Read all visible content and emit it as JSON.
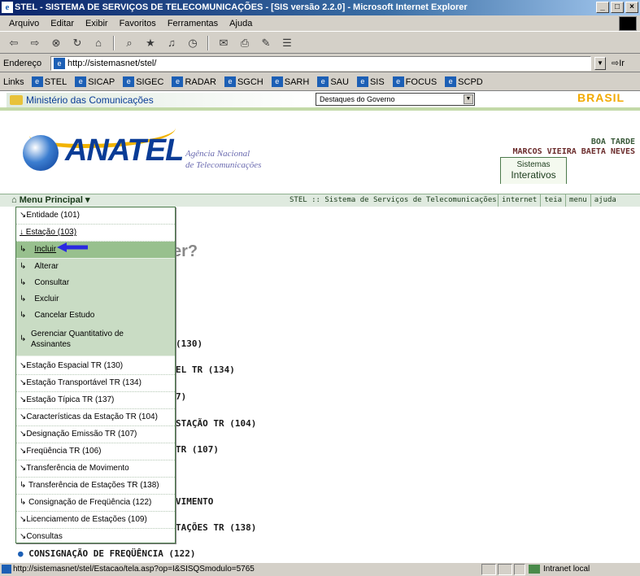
{
  "window": {
    "title": "STEL - SISTEMA DE SERVIÇOS DE TELECOMUNICAÇÕES - [SIS versão 2.2.0] - Microsoft Internet Explorer",
    "minimize": "_",
    "maximize": "□",
    "close": "×"
  },
  "menu": [
    "Arquivo",
    "Editar",
    "Exibir",
    "Favoritos",
    "Ferramentas",
    "Ajuda"
  ],
  "address": {
    "label": "Endereço",
    "url": "http://sistemasnet/stel/",
    "go": "Ir"
  },
  "links": {
    "label": "Links",
    "items": [
      "STEL",
      "SICAP",
      "SIGEC",
      "RADAR",
      "SGCH",
      "SARH",
      "SAU",
      "SIS",
      "FOCUS",
      "SCPD"
    ]
  },
  "gov": {
    "ministerio": "Ministério das Comunicações",
    "destaques": "Destaques do Governo",
    "brasil": "BRASIL"
  },
  "header": {
    "logo": "ANATEL",
    "agencia_l1": "Agência Nacional",
    "agencia_l2": "de Telecomunicações",
    "greeting": "BOA TARDE",
    "user": "MARCOS VIEIRA BAETA NEVES",
    "sistemas_l1": "Sistemas",
    "sistemas_l2": "Interativos"
  },
  "navbar": {
    "menu_principal": "Menu Principal ▾",
    "system": "STEL :: Sistema de Serviços de Telecomunicações",
    "links": [
      "internet",
      "teia",
      "menu",
      "ajuda"
    ]
  },
  "dropdown": {
    "items": [
      {
        "label": "↘Entidade (101)"
      },
      {
        "label": "↓ Estação (103)"
      },
      {
        "label": "Incluir"
      },
      {
        "label": "Alterar"
      },
      {
        "label": "Consultar"
      },
      {
        "label": "Excluir"
      },
      {
        "label": "Cancelar Estudo"
      },
      {
        "label": "Gerenciar Quantitativo de"
      },
      {
        "label": "Assinantes"
      },
      {
        "label": "↘Estação Espacial TR (130)"
      },
      {
        "label": "↘Estação Transportável TR (134)"
      },
      {
        "label": "↘Estação Típica TR (137)"
      },
      {
        "label": "↘Características da Estação TR (104)"
      },
      {
        "label": "↘Designação Emissão TR (107)"
      },
      {
        "label": "↘Freqüência TR (106)"
      },
      {
        "label": "↘Transferência de Movimento"
      },
      {
        "label": "↳ Transferência de Estações TR (138)"
      },
      {
        "label": "↳ Consignação de Freqüência (122)"
      },
      {
        "label": "↘Licenciamento de Estações (109)"
      },
      {
        "label": "↘Consultas"
      }
    ],
    "sub_arrow": "↳"
  },
  "background": {
    "q": "er?",
    "lines": [
      "(130)",
      "EL TR (134)",
      "7)",
      "STAÇÃO TR (104)",
      "TR (107)",
      "VIMENTO",
      "TAÇÕES TR (138)"
    ],
    "consignacao": "CONSIGNAÇÃO DE FREQÜÊNCIA (122)"
  },
  "status": {
    "url": "http://sistemasnet/stel/Estacao/tela.asp?op=I&SISQSmodulo=5765",
    "zone": "Intranet local"
  }
}
